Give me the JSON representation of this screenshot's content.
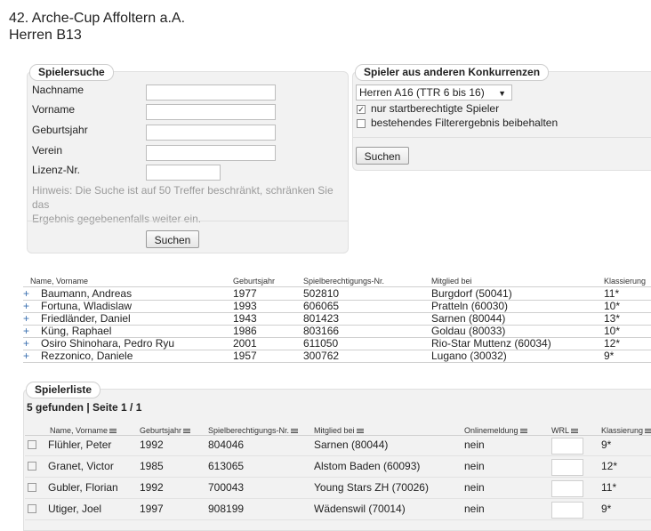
{
  "header": {
    "line1": "42. Arche-Cup Affoltern a.A.",
    "line2": "Herren B13"
  },
  "player_search": {
    "legend": "Spielersuche",
    "fields": [
      {
        "label": "Nachname",
        "value": ""
      },
      {
        "label": "Vorname",
        "value": ""
      },
      {
        "label": "Geburtsjahr",
        "value": ""
      },
      {
        "label": "Verein",
        "value": ""
      },
      {
        "label": "Lizenz-Nr.",
        "value": ""
      }
    ],
    "hint_line1": "Hinweis: Die Suche ist auf 50 Treffer beschränkt, schränken Sie das",
    "hint_line2": "Ergebnis gegebenenfalls weiter ein.",
    "search_button": "Suchen"
  },
  "other_competitions": {
    "legend": "Spieler aus anderen Konkurrenzen",
    "select_value": "Herren A16 (TTR 6 bis 16)",
    "checkbox1_label": "nur startberechtigte Spieler",
    "checkbox1_checked": true,
    "checkbox2_label": "bestehendes Filterergebnis beibehalten",
    "checkbox2_checked": false,
    "search_button": "Suchen"
  },
  "results": {
    "headers": [
      "Name, Vorname",
      "Geburtsjahr",
      "Spielberechtigungs-Nr.",
      "Mitglied bei",
      "Klassierung"
    ],
    "rows": [
      [
        "Baumann, Andreas",
        "1977",
        "502810",
        "Burgdorf (50041)",
        "11*"
      ],
      [
        "Fortuna, Wladislaw",
        "1993",
        "606065",
        "Pratteln (60030)",
        "10*"
      ],
      [
        "Friedländer, Daniel",
        "1943",
        "801423",
        "Sarnen (80044)",
        "13*"
      ],
      [
        "Küng, Raphael",
        "1986",
        "803166",
        "Goldau (80033)",
        "10*"
      ],
      [
        "Osiro Shinohara, Pedro Ryu",
        "2001",
        "611050",
        "Rio-Star Muttenz (60034)",
        "12*"
      ],
      [
        "Rezzonico, Daniele",
        "1957",
        "300762",
        "Lugano (30032)",
        "9*"
      ]
    ]
  },
  "player_list": {
    "legend": "Spielerliste",
    "summary": "5 gefunden | Seite 1 / 1",
    "headers": [
      "Name, Vorname",
      "Geburtsjahr",
      "Spielberechtigungs-Nr.",
      "Mitglied bei",
      "Onlinemeldung",
      "WRL",
      "Klassierung"
    ],
    "rows": [
      [
        "Flühler, Peter",
        "1992",
        "804046",
        "Sarnen (80044)",
        "nein",
        "9*"
      ],
      [
        "Granet, Victor",
        "1985",
        "613065",
        "Alstom Baden (60093)",
        "nein",
        "12*"
      ],
      [
        "Gubler, Florian",
        "1992",
        "700043",
        "Young Stars ZH (70026)",
        "nein",
        "11*"
      ],
      [
        "Utiger, Joel",
        "1997",
        "908199",
        "Wädenswil (70014)",
        "nein",
        "9*"
      ]
    ]
  }
}
